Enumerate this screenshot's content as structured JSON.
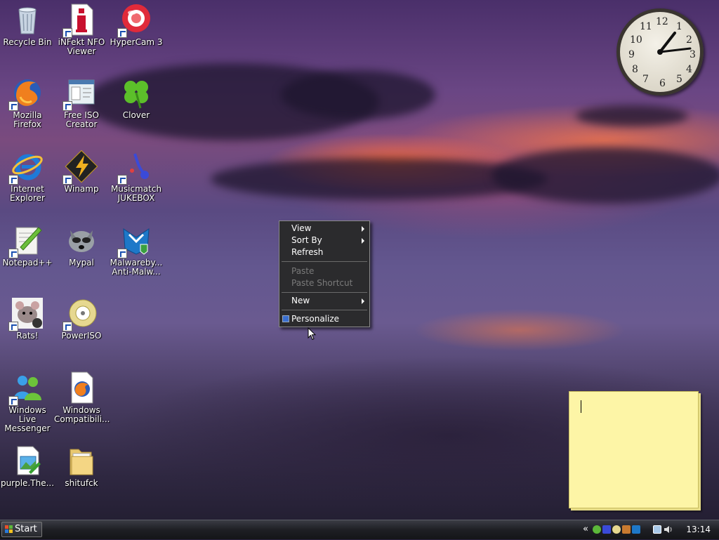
{
  "desktop": {
    "icons": [
      {
        "label": "Recycle Bin",
        "icon": "recycle-bin-icon"
      },
      {
        "label": "iNFekt NFO Viewer",
        "icon": "nfo-viewer-icon"
      },
      {
        "label": "HyperCam 3",
        "icon": "hypercam-icon"
      },
      {
        "label": "Mozilla Firefox",
        "icon": "firefox-icon"
      },
      {
        "label": "Free ISO Creator",
        "icon": "iso-creator-icon"
      },
      {
        "label": "Clover",
        "icon": "clover-icon"
      },
      {
        "label": "Internet Explorer",
        "icon": "internet-explorer-icon"
      },
      {
        "label": "Winamp",
        "icon": "winamp-icon"
      },
      {
        "label": "Musicmatch JUKEBOX",
        "icon": "musicmatch-icon"
      },
      {
        "label": "Notepad++",
        "icon": "notepad-plus-plus-icon"
      },
      {
        "label": "Mypal",
        "icon": "mypal-icon"
      },
      {
        "label": "Malwareby... Anti-Malw...",
        "icon": "malwarebytes-icon"
      },
      {
        "label": "Rats!",
        "icon": "rats-icon"
      },
      {
        "label": "PowerISO",
        "icon": "poweriso-icon"
      },
      {
        "label": "Windows Live Messenger",
        "icon": "messenger-icon"
      },
      {
        "label": "Windows Compatibili...",
        "icon": "compatibility-icon"
      },
      {
        "label": "purple.The...",
        "icon": "image-file-icon"
      },
      {
        "label": "shitufck",
        "icon": "folder-icon"
      }
    ]
  },
  "context_menu": {
    "view": "View",
    "sort_by": "Sort By",
    "refresh": "Refresh",
    "paste": "Paste",
    "paste_shortcut": "Paste Shortcut",
    "new": "New",
    "personalize": "Personalize"
  },
  "clock": {
    "numerals": [
      "12",
      "1",
      "2",
      "3",
      "4",
      "5",
      "6",
      "7",
      "8",
      "9",
      "10",
      "11"
    ]
  },
  "taskbar": {
    "start_label": "Start",
    "tray_expand": "«",
    "time": "13:14"
  },
  "colors": {
    "sticky_note": "#fdf5a6",
    "menu_bg": "#2b2b2d",
    "taskbar": "#1e1f24"
  }
}
